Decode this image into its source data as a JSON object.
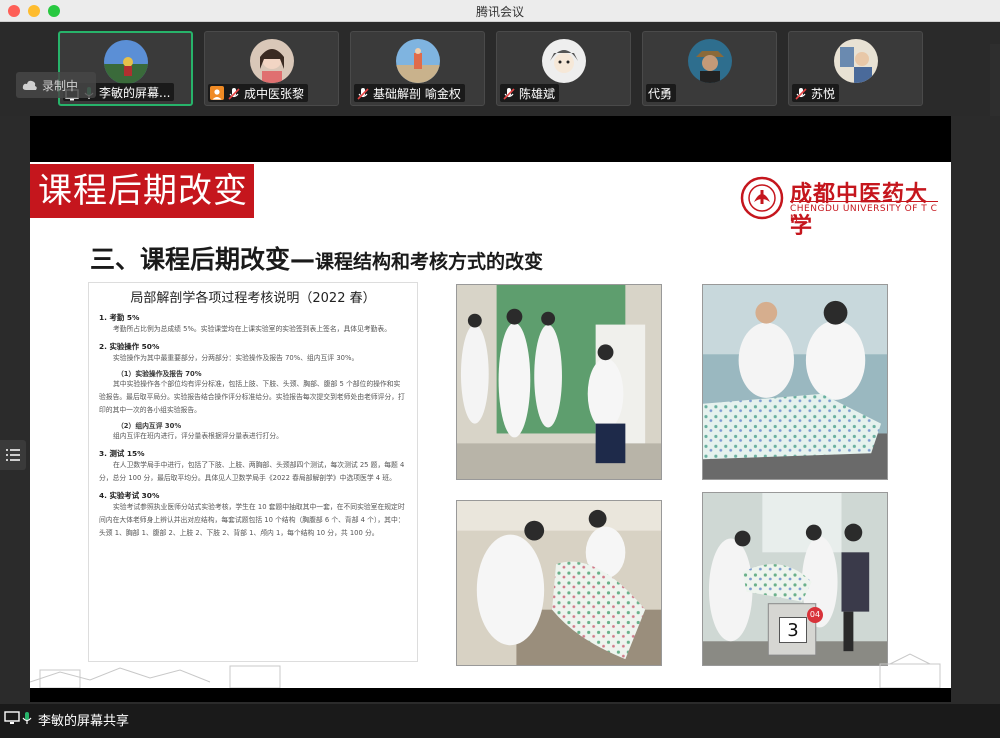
{
  "window": {
    "title": "腾讯会议"
  },
  "recording": {
    "label": "录制中"
  },
  "participants": [
    {
      "name": "李敏的屏幕...",
      "active": true,
      "badge": "screen"
    },
    {
      "name": "成中医张黎",
      "active": false,
      "badge": "person"
    },
    {
      "name": "基础解剖 喻金权",
      "active": false,
      "badge": "none"
    },
    {
      "name": "陈雄斌",
      "active": false,
      "badge": "none"
    },
    {
      "name": "代勇",
      "active": false,
      "badge": "none"
    },
    {
      "name": "苏悦",
      "active": false,
      "badge": "none"
    }
  ],
  "share": {
    "label": "李敏的屏幕共享"
  },
  "slide": {
    "banner": "课程后期改变",
    "logo_cn": "成都中医药大学",
    "logo_en": "CHENGDU UNIVERSITY OF T C M",
    "headline_big": "三、课程后期改变—",
    "headline_small": "课程结构和考核方式的改变",
    "doc": {
      "title": "局部解剖学各项过程考核说明（2022 春）",
      "s1": "1. 考勤 5%",
      "p1": "考勤所占比例为总成绩 5%。实验课堂均在上课实验室的实验签到表上签名，具体见考勤表。",
      "s2": "2. 实验操作 50%",
      "p2": "实验操作为其中最重要部分，分两部分：实验操作及报告 70%、组内互评 30%。",
      "sub1": "（1）实验操作及报告 70%",
      "p3": "其中实验操作各个部位均有评分标准，包括上肢、下肢、头颈、胸部、腹部 5 个部位的操作和实验报告。最后取平局分。实验报告结合操作评分标准给分。实验报告每次提交到老师处由老师评分，打印的其中一次的各小组实验报告。",
      "sub2": "（2）组内互评 30%",
      "p4": "组内互评在班内进行，评分量表根据评分量表进行打分。",
      "s3": "3. 测试 15%",
      "p5": "在人卫数学局手中进行，包括了下肢、上肢、两胸部、头颈部四个测试，每次测试 25 题，每题 4 分，总分 100 分，最后取平均分。具体见人卫数学局手《2022 春局部解剖学》中选项医学 4 班。",
      "s4": "4. 实验考试 30%",
      "p6": "实验考试参照执业医师分站式实验考核，学生在 10 套题中抽取其中一套，在不同实验室在规定时间内在大体老师身上辨认并出对应结构，每套试题包括 10 个结构（胸腹部 6 个、背部 4 个），其中：头颈 1、胸部 1、腹部 2、上肢 2、下肢 2、背部 1、颅内 1，每个结构 10 分，共 100 分。"
    },
    "photo4_number": "3",
    "photo4_tag": "04"
  },
  "colors": {
    "accent_red": "#c5161d",
    "active_border": "#27b36a"
  }
}
